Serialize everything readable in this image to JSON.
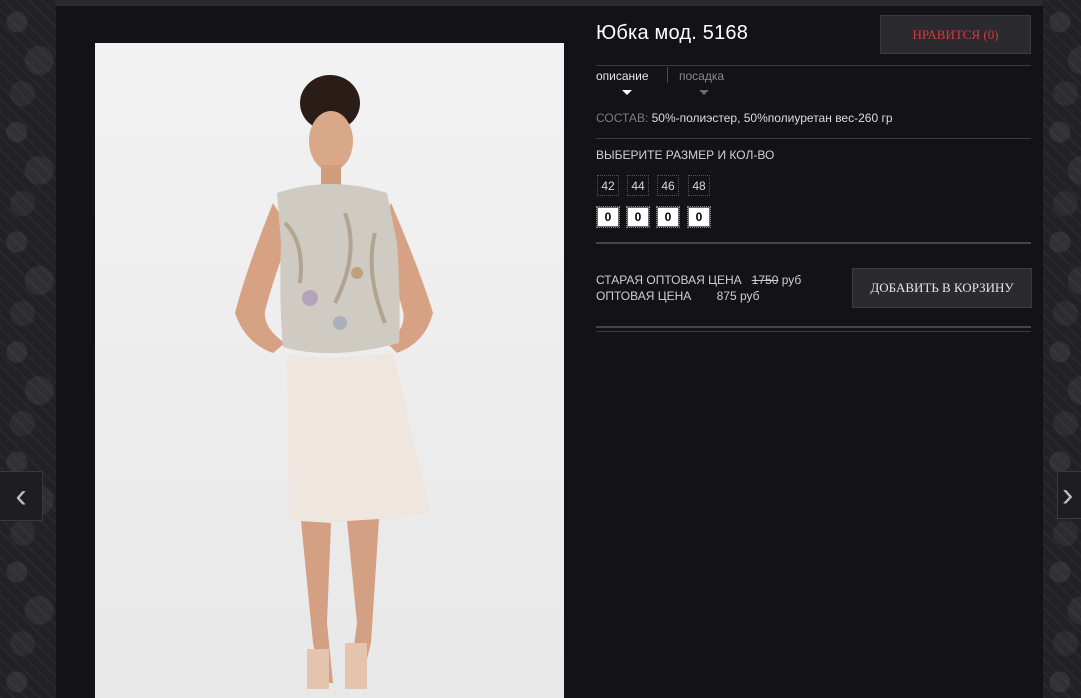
{
  "product": {
    "title": "Юбка мод. 5168",
    "like_button": "НРАВИТСЯ (0)",
    "tabs": [
      {
        "label": "описание",
        "active": true
      },
      {
        "label": "посадка",
        "active": false
      }
    ],
    "composition_label": "СОСТАВ:",
    "composition_value": "50%-полиэстер, 50%полиуретан вес-260 гр",
    "size_heading": "ВЫБЕРИТЕ РАЗМЕР И КОЛ-ВО",
    "sizes": [
      "42",
      "44",
      "46",
      "48"
    ],
    "quantities": [
      "0",
      "0",
      "0",
      "0"
    ],
    "old_price_label": "СТАРАЯ ОПТОВАЯ ЦЕНА",
    "old_price_value": "1750",
    "old_price_currency": "руб",
    "price_label": "ОПТОВАЯ ЦЕНА",
    "price_value": "875 руб",
    "add_to_cart": "ДОБАВИТЬ В КОРЗИНУ"
  },
  "navigation": {
    "prev_icon": "chevron-left-icon",
    "next_icon": "chevron-right-icon"
  },
  "colors": {
    "accent_red": "#d8393c",
    "panel_bg": "#131216"
  }
}
